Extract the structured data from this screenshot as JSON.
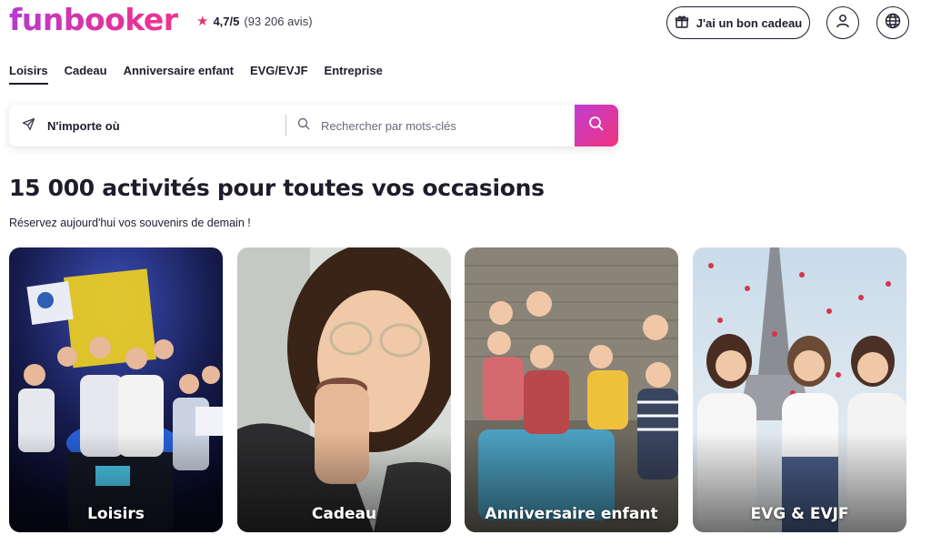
{
  "header": {
    "logo": "funbooker",
    "rating": {
      "score": "4,7/5",
      "count": "(93 206 avis)"
    },
    "gift_button": "J'ai un bon cadeau"
  },
  "nav": {
    "tabs": [
      "Loisirs",
      "Cadeau",
      "Anniversaire enfant",
      "EVG/EVJF",
      "Entreprise"
    ],
    "active": "Loisirs"
  },
  "search": {
    "location": "N'importe où",
    "keywords_placeholder": "Rechercher par mots-clés"
  },
  "hero": {
    "title": "15 000 activités pour toutes vos occasions",
    "subtitle": "Réservez aujourd'hui vos souvenirs de demain !"
  },
  "cards": [
    {
      "label": "Loisirs"
    },
    {
      "label": "Cadeau"
    },
    {
      "label": "Anniversaire enfant"
    },
    {
      "label": "EVG & EVJF"
    }
  ],
  "colors": {
    "brand_gradient_start": "#b63ad0",
    "brand_gradient_end": "#f0338e",
    "star": "#e7386f",
    "text": "#1d1d2c"
  },
  "icons": {
    "rating": "star-icon",
    "gift": "gift-icon",
    "account": "user-icon",
    "language": "globe-icon",
    "location": "send-arrow-icon",
    "keywords": "search-icon",
    "search_button": "search-icon"
  }
}
